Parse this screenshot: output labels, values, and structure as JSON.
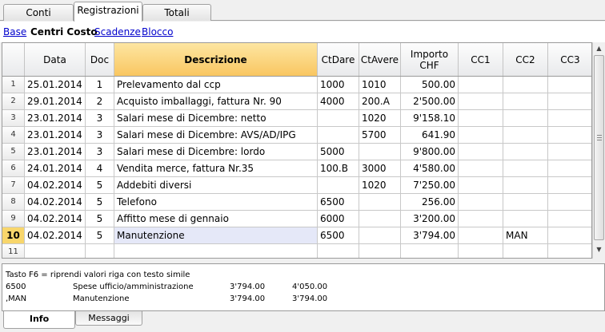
{
  "tabs": [
    "Conti",
    "Registrazioni",
    "Totali"
  ],
  "active_tab": "Registrazioni",
  "views": [
    "Base",
    "Centri Costo",
    "Scadenze",
    "Blocco"
  ],
  "current_view": "Centri Costo",
  "columns": [
    "Data",
    "Doc",
    "Descrizione",
    "CtDare",
    "CtAvere",
    "Importo CHF",
    "CC1",
    "CC2",
    "CC3"
  ],
  "selected_column": "Descrizione",
  "rows": [
    {
      "n": "1",
      "data": "25.01.2014",
      "doc": "1",
      "desc": "Prelevamento dal ccp",
      "dare": "1000",
      "avere": "1010",
      "importo": "500.00",
      "cc1": "",
      "cc2": "",
      "cc3": ""
    },
    {
      "n": "2",
      "data": "29.01.2014",
      "doc": "2",
      "desc": "Acquisto imballaggi, fattura Nr. 90",
      "dare": "4000",
      "avere": "200.A",
      "importo": "2'500.00",
      "cc1": "",
      "cc2": "",
      "cc3": ""
    },
    {
      "n": "3",
      "data": "23.01.2014",
      "doc": "3",
      "desc": "Salari mese di Dicembre: netto",
      "dare": "",
      "avere": "1020",
      "importo": "9'158.10",
      "cc1": "",
      "cc2": "",
      "cc3": ""
    },
    {
      "n": "4",
      "data": "23.01.2014",
      "doc": "3",
      "desc": "Salari mese di Dicembre: AVS/AD/IPG",
      "dare": "",
      "avere": "5700",
      "importo": "641.90",
      "cc1": "",
      "cc2": "",
      "cc3": ""
    },
    {
      "n": "5",
      "data": "23.01.2014",
      "doc": "3",
      "desc": "Salari mese di Dicembre: lordo",
      "dare": "5000",
      "avere": "",
      "importo": "9'800.00",
      "cc1": "",
      "cc2": "",
      "cc3": ""
    },
    {
      "n": "6",
      "data": "24.01.2014",
      "doc": "4",
      "desc": "Vendita merce, fattura Nr.35",
      "dare": "100.B",
      "avere": "3000",
      "importo": "4'580.00",
      "cc1": "",
      "cc2": "",
      "cc3": ""
    },
    {
      "n": "7",
      "data": "04.02.2014",
      "doc": "5",
      "desc": "Addebiti diversi",
      "dare": "",
      "avere": "1020",
      "importo": "7'250.00",
      "cc1": "",
      "cc2": "",
      "cc3": ""
    },
    {
      "n": "8",
      "data": "04.02.2014",
      "doc": "5",
      "desc": "Telefono",
      "dare": "6500",
      "avere": "",
      "importo": "256.00",
      "cc1": "",
      "cc2": "",
      "cc3": ""
    },
    {
      "n": "9",
      "data": "04.02.2014",
      "doc": "5",
      "desc": "Affitto mese di gennaio",
      "dare": "6000",
      "avere": "",
      "importo": "3'200.00",
      "cc1": "",
      "cc2": "",
      "cc3": ""
    },
    {
      "n": "10",
      "data": "04.02.2014",
      "doc": "5",
      "desc": "Manutenzione",
      "dare": "6500",
      "avere": "",
      "importo": "3'794.00",
      "cc1": "",
      "cc2": "MAN",
      "cc3": "",
      "current": true
    },
    {
      "n": "11",
      "data": "",
      "doc": "",
      "desc": "",
      "dare": "",
      "avere": "",
      "importo": "",
      "cc1": "",
      "cc2": "",
      "cc3": ""
    }
  ],
  "info": {
    "hint": "Tasto F6 = riprendi valori riga con testo simile",
    "lines": [
      {
        "code": "6500",
        "label": "Spese ufficio/amministrazione",
        "v1": "3'794.00",
        "v2": "4'050.00"
      },
      {
        "code": ",MAN",
        "label": "Manutenzione",
        "v1": "3'794.00",
        "v2": "3'794.00"
      }
    ]
  },
  "bottom_tabs": [
    "Info",
    "Messaggi"
  ],
  "active_bottom_tab": "Info",
  "scroll_icons": [
    "arrow-up-icon",
    "arrow-down-icon"
  ]
}
